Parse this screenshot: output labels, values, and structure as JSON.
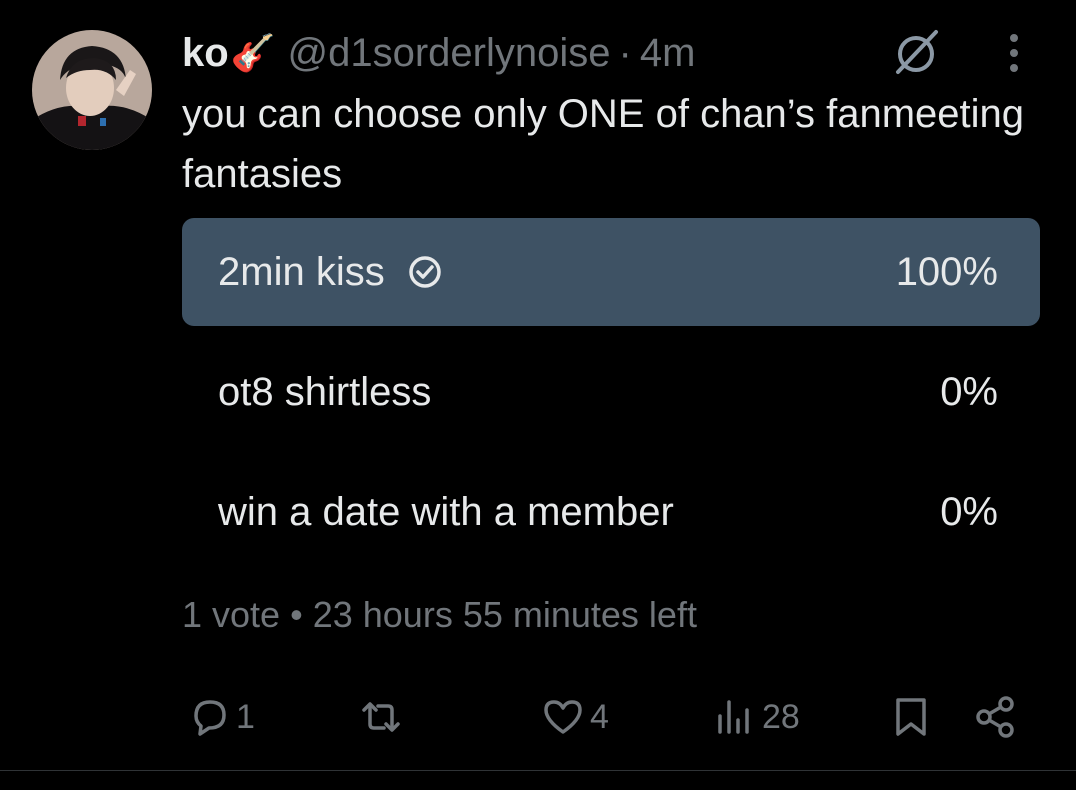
{
  "tweet": {
    "display_name": "ko",
    "name_emoji": "🎸",
    "handle": "@d1sorderlynoise",
    "separator": "·",
    "time": "4m",
    "text": "you can choose only ONE of chan’s fanmeeting fantasies"
  },
  "poll": {
    "options": [
      {
        "label": "2min kiss",
        "percent_text": "100%",
        "percent": 100,
        "selected": true
      },
      {
        "label": "ot8 shirtless",
        "percent_text": "0%",
        "percent": 0,
        "selected": false
      },
      {
        "label": "win a date with a member",
        "percent_text": "0%",
        "percent": 0,
        "selected": false
      }
    ],
    "votes": "1 vote",
    "bullet": "•",
    "time_left": "23 hours 55 minutes left"
  },
  "actions": {
    "reply_count": "1",
    "retweet_count": "",
    "like_count": "4",
    "views_count": "28"
  },
  "colors": {
    "background": "#000000",
    "text": "#e7e9ea",
    "muted": "#71767b",
    "poll_fill": "#3e5264"
  },
  "icons": [
    "grok-icon",
    "more-icon",
    "check-circle-icon",
    "reply-icon",
    "retweet-icon",
    "like-icon",
    "views-icon",
    "bookmark-icon",
    "share-icon"
  ]
}
